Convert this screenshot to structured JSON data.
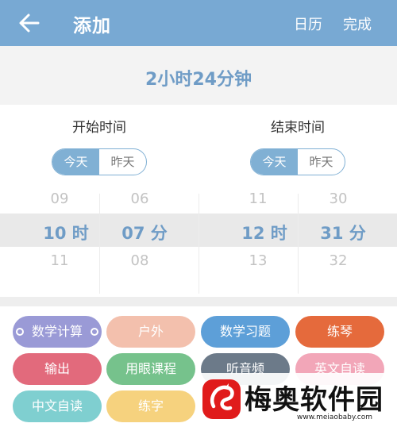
{
  "header": {
    "title": "添加",
    "calendar_label": "日历",
    "done_label": "完成"
  },
  "duration": "2小时24分钟",
  "start": {
    "label": "开始时间",
    "toggle": {
      "today": "今天",
      "yesterday": "昨天",
      "selected": "today"
    },
    "hours": {
      "prev": "09",
      "current": "10 时",
      "next": "11"
    },
    "minutes": {
      "prev": "06",
      "current": "07 分",
      "next": "08"
    }
  },
  "end": {
    "label": "结束时间",
    "toggle": {
      "today": "今天",
      "yesterday": "昨天",
      "selected": "today"
    },
    "hours": {
      "prev": "11",
      "current": "12 时",
      "next": "13"
    },
    "minutes": {
      "prev": "30",
      "current": "31 分",
      "next": "32"
    }
  },
  "tags": [
    {
      "label": "数学计算",
      "color": "#9a9ad6",
      "selected": true
    },
    {
      "label": "户外",
      "color": "#f3c0ad"
    },
    {
      "label": "数学习题",
      "color": "#5d9fd8"
    },
    {
      "label": "练琴",
      "color": "#e56a3c"
    },
    {
      "label": "输出",
      "color": "#e26a7c"
    },
    {
      "label": "用眼课程",
      "color": "#76c28c"
    },
    {
      "label": "听音频",
      "color": "#6c7a89"
    },
    {
      "label": "英文自读",
      "color": "#f2a6b8"
    },
    {
      "label": "中文自读",
      "color": "#7fcfd0"
    },
    {
      "label": "练字",
      "color": "#f6d27e"
    }
  ],
  "watermark": {
    "text": "梅奥软件园",
    "url": "www.meiaobaby.com"
  },
  "colors": {
    "header": "#78a9d3",
    "accent": "#6f9cc6",
    "toggle": "#80b0d4"
  },
  "icons": {
    "back": "arrow-left-icon",
    "logo": "dragon-logo-icon"
  }
}
